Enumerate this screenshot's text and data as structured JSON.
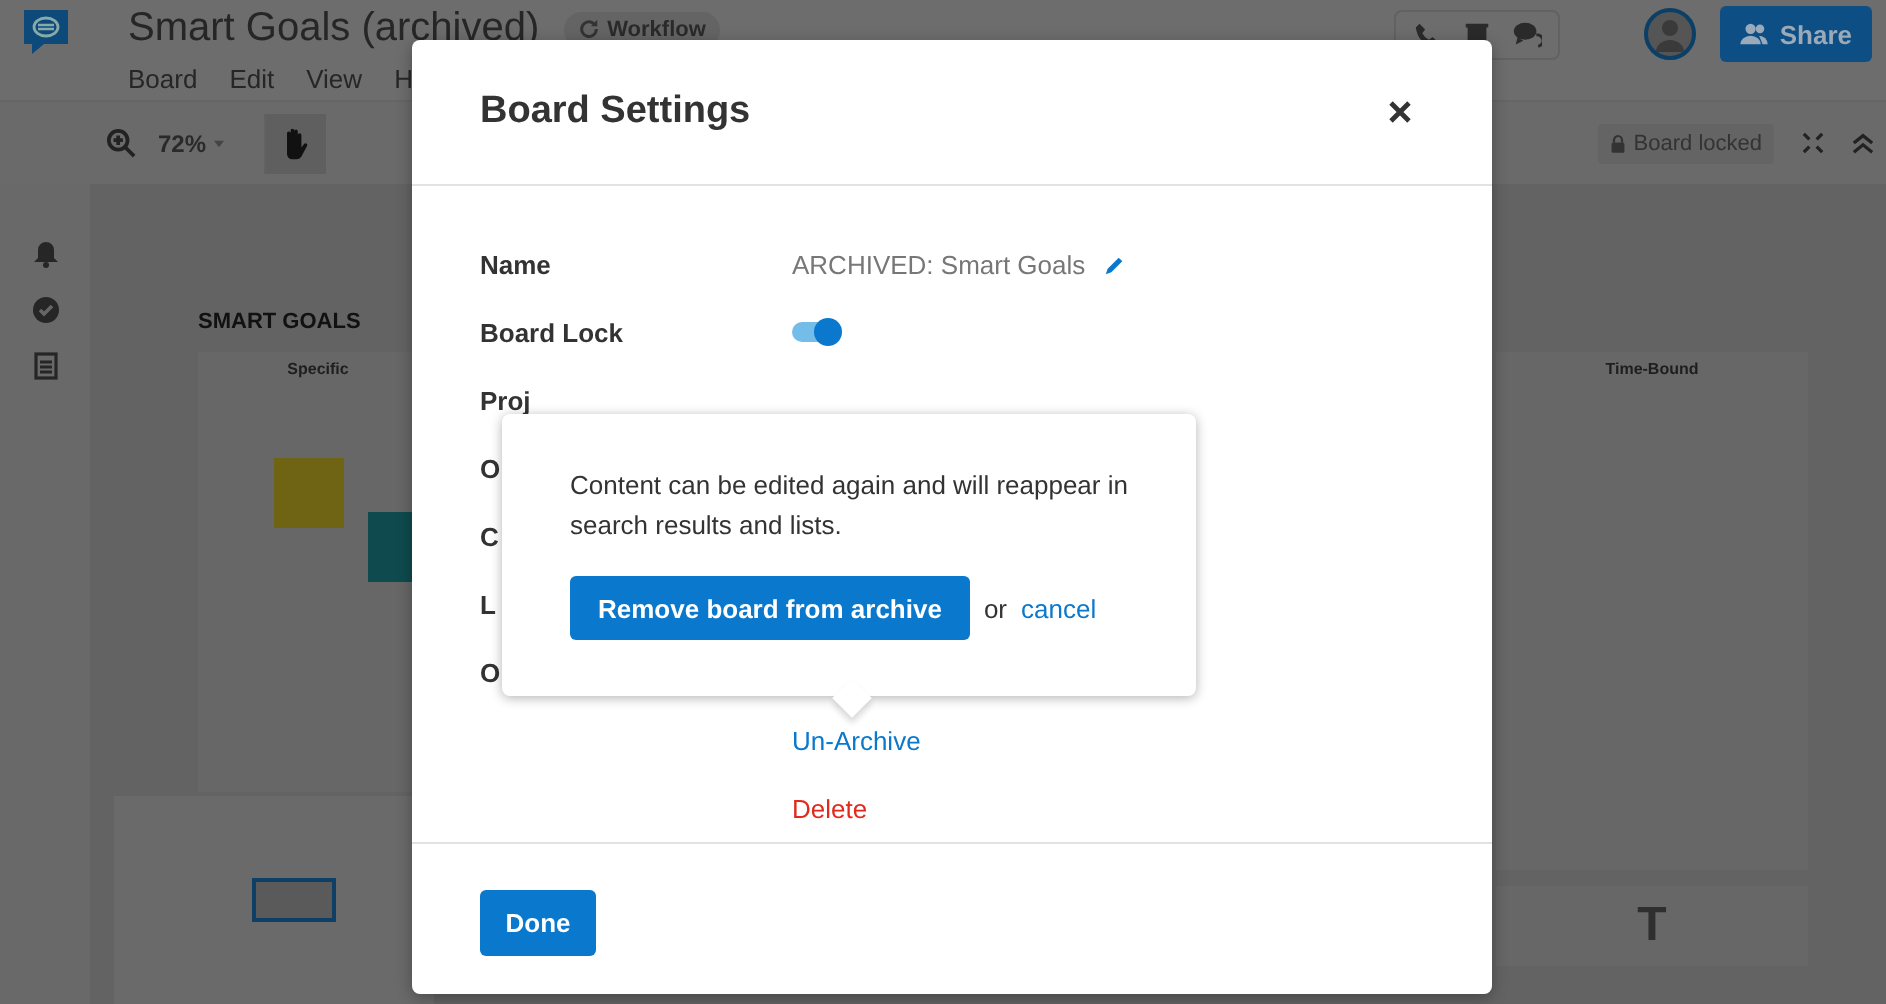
{
  "app": {
    "title": "Smart Goals (archived)",
    "workflow_badge": "Workflow",
    "menu": [
      "Board",
      "Edit",
      "View",
      "H"
    ],
    "zoom": "72%",
    "share": "Share",
    "board_locked": "Board locked"
  },
  "canvas": {
    "heading": "SMART GOALS",
    "columns": [
      {
        "title": "Specific"
      },
      {
        "title": "Time-Bound"
      }
    ],
    "text_tool": "T"
  },
  "dialog": {
    "title": "Board Settings",
    "rows": [
      {
        "kind": "text",
        "label": "Name",
        "value": "ARCHIVED: Smart Goals",
        "editable": true
      },
      {
        "kind": "toggle",
        "label": "Board Lock",
        "on": true
      },
      {
        "kind": "label",
        "label": "Proj"
      },
      {
        "kind": "label",
        "label": "O"
      },
      {
        "kind": "label",
        "label": "C"
      },
      {
        "kind": "label",
        "label": "L"
      },
      {
        "kind": "label",
        "label": "O"
      },
      {
        "kind": "link",
        "value": "Un-Archive"
      },
      {
        "kind": "danger",
        "value": "Delete"
      }
    ],
    "done": "Done"
  },
  "popover": {
    "message": "Content can be edited again and will reappear in search results and lists.",
    "confirm": "Remove board from archive",
    "or": "or",
    "cancel": "cancel"
  }
}
